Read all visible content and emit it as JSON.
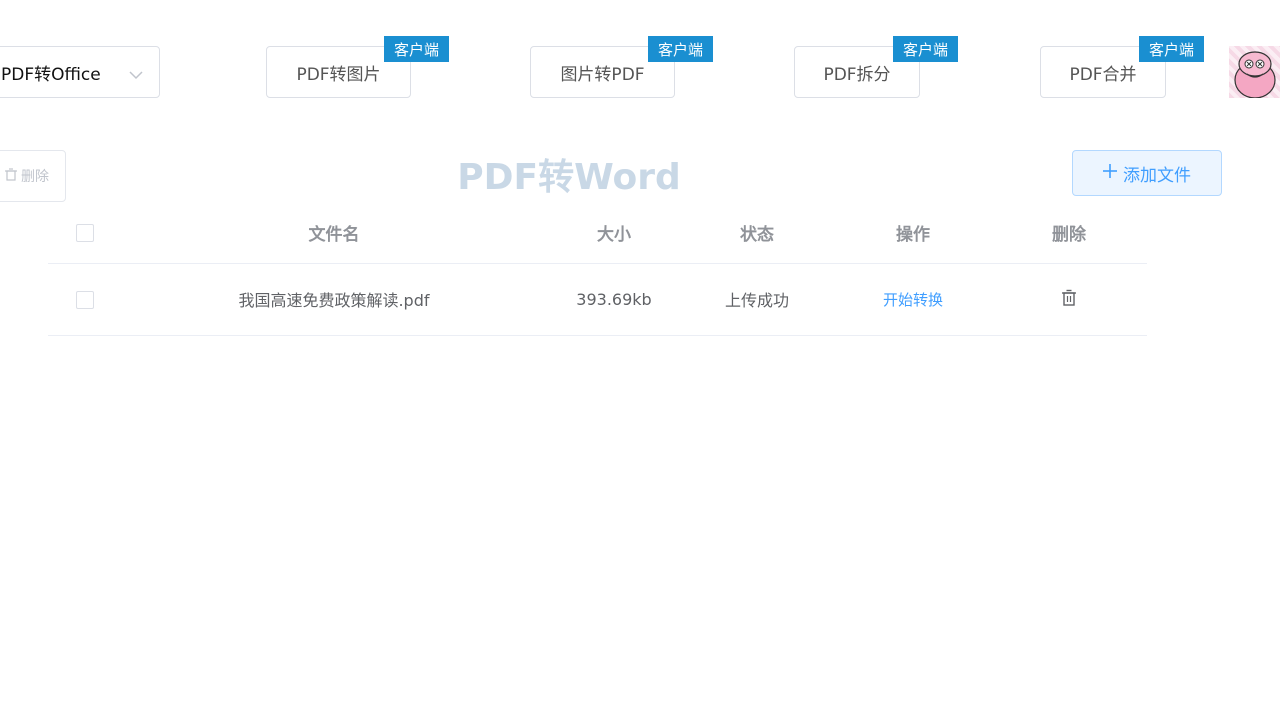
{
  "nav": {
    "select_label": "PDF转Office",
    "buttons": [
      {
        "label": "PDF转图片",
        "badge": "客户端"
      },
      {
        "label": "图片转PDF",
        "badge": "客户端"
      },
      {
        "label": "PDF拆分",
        "badge": "客户端"
      },
      {
        "label": "PDF合并",
        "badge": "客户端"
      }
    ]
  },
  "toolbar": {
    "delete_label": "删除",
    "title": "PDF转Word",
    "add_file_label": "添加文件"
  },
  "table": {
    "headers": {
      "filename": "文件名",
      "size": "大小",
      "status": "状态",
      "action": "操作",
      "delete": "删除"
    },
    "rows": [
      {
        "filename": "我国高速免费政策解读.pdf",
        "size": "393.69kb",
        "status": "上传成功",
        "action": "开始转换"
      }
    ]
  },
  "colors": {
    "accent": "#409eff",
    "badge": "#1a8fd1",
    "title": "#c9d8e6"
  }
}
